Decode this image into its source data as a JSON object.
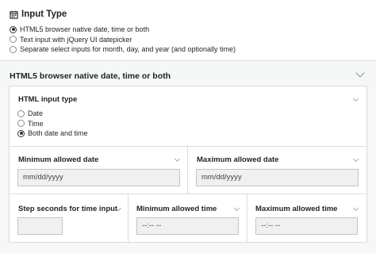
{
  "input_type": {
    "title": "Input Type",
    "options": [
      {
        "label": "HTML5 browser native date, time or both",
        "checked": true
      },
      {
        "label": "Text input with jQuery UI datepicker",
        "checked": false
      },
      {
        "label": "Separate select inputs for month, day, and year (and optionally time)",
        "checked": false
      }
    ]
  },
  "section": {
    "title": "HTML5 browser native date, time or both"
  },
  "html_input_type": {
    "label": "HTML input type",
    "options": [
      {
        "label": "Date",
        "checked": false
      },
      {
        "label": "Time",
        "checked": false
      },
      {
        "label": "Both date and time",
        "checked": true
      }
    ]
  },
  "min_date": {
    "label": "Minimum allowed date",
    "placeholder": "mm/dd/yyyy"
  },
  "max_date": {
    "label": "Maximum allowed date",
    "placeholder": "mm/dd/yyyy"
  },
  "step_seconds": {
    "label": "Step seconds for time input",
    "value": ""
  },
  "min_time": {
    "label": "Minimum allowed time",
    "placeholder": "--:-- --"
  },
  "max_time": {
    "label": "Maximum allowed time",
    "placeholder": "--:-- --"
  },
  "icons": {
    "input_type": "calendar-icon",
    "collapse": "chevron-down-icon"
  }
}
